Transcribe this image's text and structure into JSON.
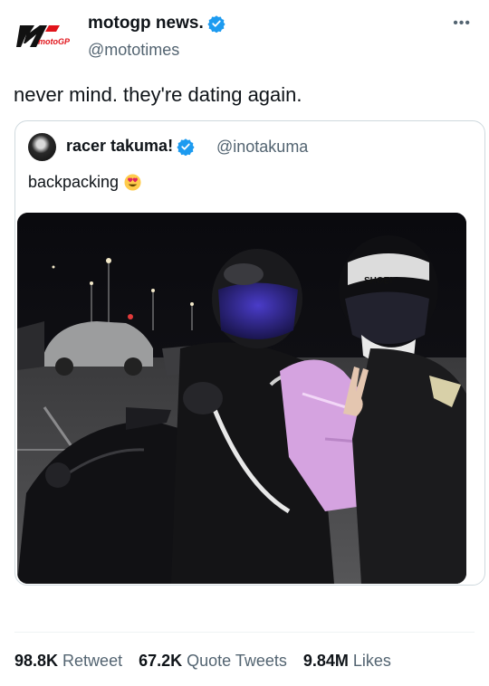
{
  "tweet": {
    "author_name": "motogp news.",
    "author_handle": "@mototimes",
    "logo_text": "motoGP",
    "more_label": "•••",
    "text": "never mind. they're dating again."
  },
  "quoted_tweet": {
    "author_name": "racer takuma!",
    "author_handle": "@inotakuma",
    "text": "backpacking",
    "emoji": "smiling-face-with-heart-eyes",
    "photo": {
      "helmet_brand_text": "SHOEI"
    }
  },
  "stats": [
    {
      "count": "98.8K",
      "label": "Retweet"
    },
    {
      "count": "67.2K",
      "label": "Quote Tweets"
    },
    {
      "count": "9.84M",
      "label": "Likes"
    }
  ],
  "colors": {
    "verified": "#1d9bf0",
    "secondary_text": "#536471",
    "logo_red": "#e1141b",
    "border": "#cfd9de"
  },
  "icons": {
    "verified": "verified-badge-icon",
    "more": "more-options-icon",
    "logo": "motogp-logo-icon"
  }
}
